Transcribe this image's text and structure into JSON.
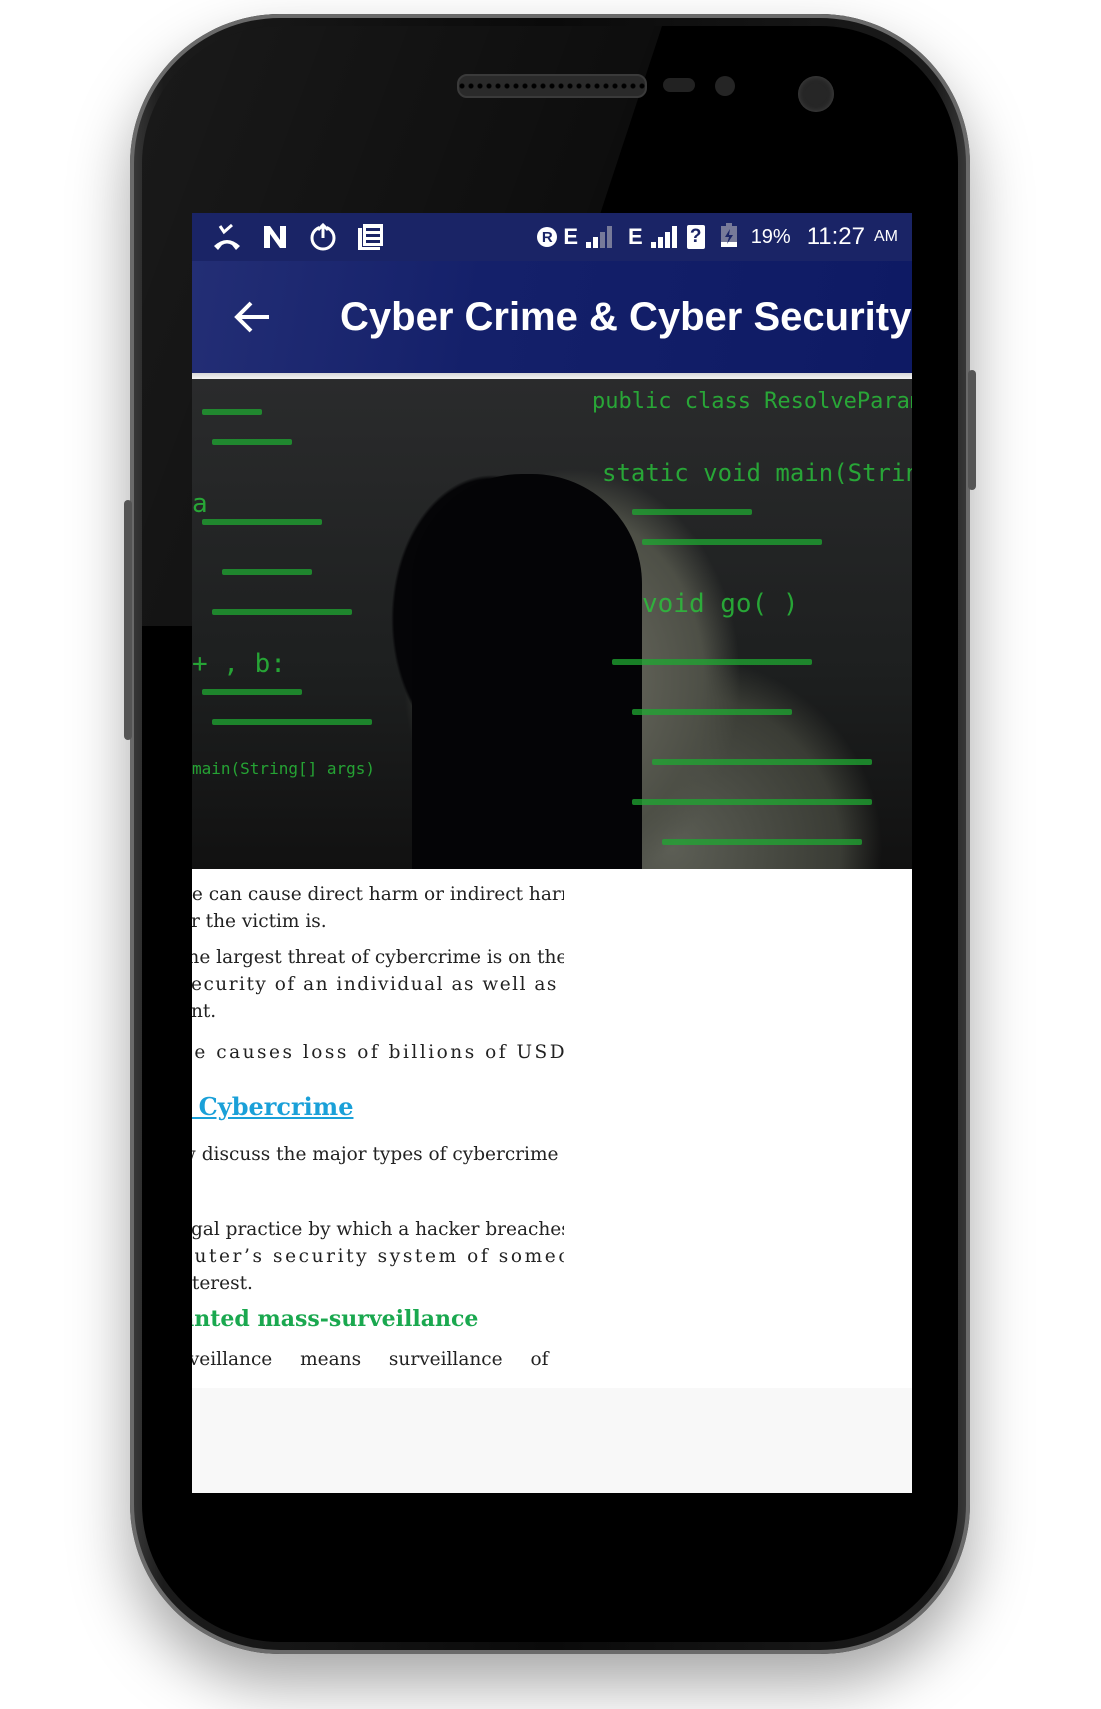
{
  "statusbar": {
    "left_icons": [
      "missed-call-icon",
      "n-app-icon",
      "power-upload-icon",
      "news-icon"
    ],
    "roaming_badge": "R",
    "network1": "E",
    "network2": "E",
    "sim_unknown": "?",
    "battery_percent": "19%",
    "time": "11:27",
    "ampm": "AM"
  },
  "appbar": {
    "back_icon": "arrow-left-icon",
    "title": "Cyber Crime & Cyber Security"
  },
  "hero_image": {
    "alt": "Hooded figure with green code overlay"
  },
  "article": {
    "lines": [
      "ne can cause direct harm or indirect harm",
      "er the victim is.",
      " the largest threat of cybercrime is on the",
      "security of an individual as well as the",
      "ent.",
      "ne causes loss of billions of USD every"
    ],
    "section_heading": "f Cybercrime",
    "intro_line": "w discuss the major types of cybercrime −",
    "hacking_lines": [
      "egal practice by which a hacker breaches",
      "puter’s security system of someone for",
      "nterest."
    ],
    "subheading": "anted mass-surveillance",
    "surveillance_line": "rveillance means surveillance of a"
  },
  "colors": {
    "appbar": "#14206a",
    "link_heading": "#1aa0d8",
    "sub_heading": "#1aa84f"
  }
}
